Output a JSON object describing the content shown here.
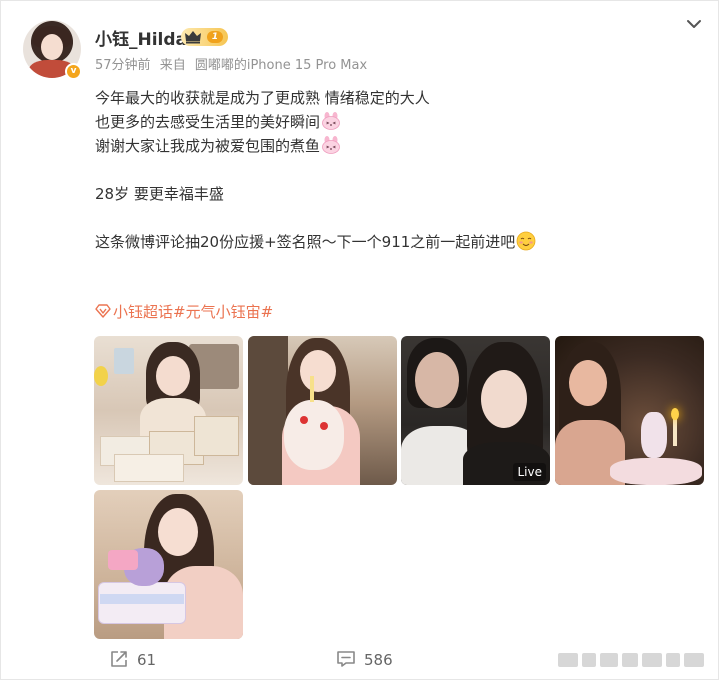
{
  "post": {
    "author": "小钰_Hilda",
    "level": "1",
    "verified_mark": "v",
    "time": "57分钟前",
    "source_prefix": "来自",
    "source_device": "圆嘟嘟的iPhone 15 Pro Max",
    "lines": [
      "今年最大的收获就是成为了更成熟 情绪稳定的大人",
      "也更多的去感受生活里的美好瞬间",
      "谢谢大家让我成为被爱包围的煮鱼",
      "28岁 要更幸福丰盛",
      "这条微博评论抽20份应援+签名照～下一个911之前一起前进吧"
    ],
    "topics": [
      "小钰超话",
      "#元气小钰宙#"
    ],
    "emoji_names": [
      "bunny-emoji",
      "bunny-emoji",
      "blush-smile-emoji"
    ],
    "photos": [
      {
        "name": "photo-gifts"
      },
      {
        "name": "photo-cake-pink-dress"
      },
      {
        "name": "photo-couple",
        "badge": "Live"
      },
      {
        "name": "photo-candles"
      },
      {
        "name": "photo-stellalou-cake"
      }
    ]
  },
  "actions": {
    "share_count": "61",
    "comment_count": "586"
  },
  "icons": {
    "share": "share-icon",
    "comment": "comment-icon",
    "more": "chevron-down-icon",
    "topic": "super-topic-icon",
    "level": "crown-icon"
  },
  "colors": {
    "topic": "#eb7350",
    "meta": "#939393",
    "verified": "#f4a51c",
    "level_badge": "#f6c552"
  }
}
